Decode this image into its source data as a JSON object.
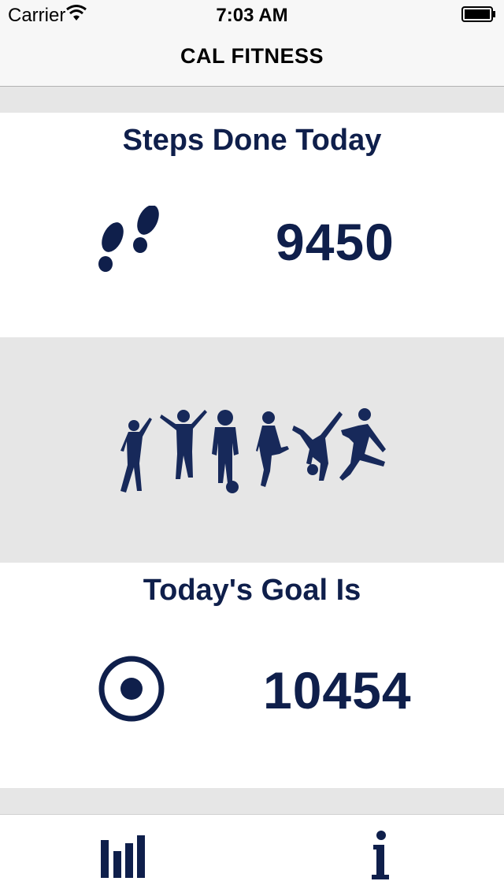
{
  "status_bar": {
    "carrier": "Carrier",
    "time": "7:03 AM"
  },
  "nav": {
    "title": "CAL FITNESS"
  },
  "steps_card": {
    "title": "Steps Done Today",
    "value": "9450",
    "icon": "footprints-icon"
  },
  "banner": {
    "icon": "people-silhouettes-icon"
  },
  "goal_card": {
    "title": "Today's Goal Is",
    "value": "10454",
    "icon": "target-icon"
  },
  "tab_bar": {
    "items": [
      {
        "icon": "bar-chart-icon"
      },
      {
        "icon": "info-icon"
      }
    ]
  },
  "colors": {
    "accent": "#0f1f4b",
    "gray": "#e6e6e6",
    "bar": "#f7f7f7"
  }
}
